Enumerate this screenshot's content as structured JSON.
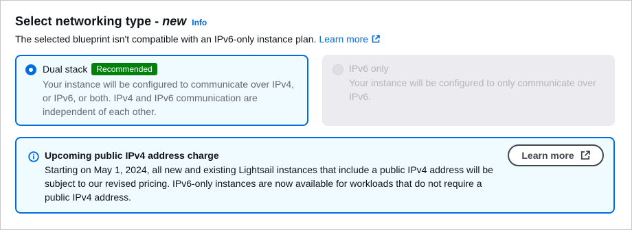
{
  "header": {
    "title": "Select networking type",
    "separator": "-",
    "title_badge": "new",
    "info_label": "Info",
    "description": "The selected blueprint isn't compatible with an IPv6-only instance plan.",
    "learn_more": "Learn more"
  },
  "options": [
    {
      "label": "Dual stack",
      "badge": "Recommended",
      "description": "Your instance will be configured to communicate over IPv4, or IPv6, or both. IPv4 and IPv6 communication are independent of each other.",
      "selected": true,
      "disabled": false
    },
    {
      "label": "IPv6 only",
      "description": "Your instance will be configured to only communicate over IPv6.",
      "selected": false,
      "disabled": true
    }
  ],
  "alert": {
    "title": "Upcoming public IPv4 address charge",
    "text": "Starting on May 1, 2024, all new and existing Lightsail instances that include a public IPv4 address will be subject to our revised pricing. IPv6-only instances are now available for workloads that do not require a public IPv4 address.",
    "button_label": "Learn more",
    "icon": "info-circle-icon"
  },
  "colors": {
    "accent": "#006ce0",
    "selected_bg": "#f0fbff",
    "disabled_bg": "#ebebf0",
    "badge_green": "#037f0c"
  }
}
